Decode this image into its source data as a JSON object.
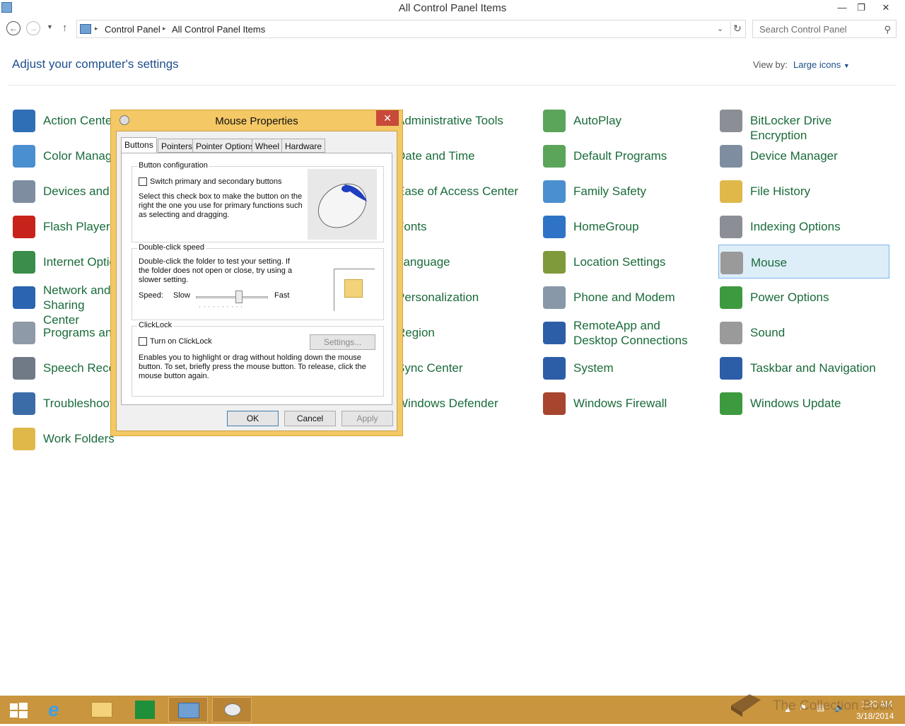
{
  "window": {
    "title": "All Control Panel Items"
  },
  "address": {
    "crumbs": [
      "Control Panel",
      "All Control Panel Items"
    ],
    "search_placeholder": "Search Control Panel"
  },
  "main": {
    "heading": "Adjust your computer's settings",
    "view_by_label": "View by:",
    "view_by_value": "Large icons"
  },
  "items": [
    {
      "label": "Action Center",
      "icon": "flag-icon",
      "color": "#2f6fb5"
    },
    {
      "label": "Color Management",
      "icon": "color-management-icon",
      "color": "#4a8fcf"
    },
    {
      "label": "Devices and Printers",
      "icon": "devices-printers-icon",
      "color": "#7e8ea0"
    },
    {
      "label": "Flash Player (32-bit)",
      "icon": "flash-icon",
      "color": "#c8231b"
    },
    {
      "label": "Internet Options",
      "icon": "internet-options-icon",
      "color": "#3a8d4a"
    },
    {
      "label": "Network and Sharing Center",
      "icon": "network-icon",
      "color": "#2b64b0"
    },
    {
      "label": "Programs and Features",
      "icon": "programs-icon",
      "color": "#8e9aa8"
    },
    {
      "label": "Speech Recognition",
      "icon": "microphone-icon",
      "color": "#6f7a86"
    },
    {
      "label": "Troubleshooting",
      "icon": "troubleshooting-icon",
      "color": "#3b6ca8"
    },
    {
      "label": "Work Folders",
      "icon": "work-folders-icon",
      "color": "#e0b84a"
    },
    {
      "label": "Administrative Tools",
      "icon": "admin-tools-icon",
      "color": "#777777"
    },
    {
      "label": "Date and Time",
      "icon": "clock-icon",
      "color": "#4b7fc0"
    },
    {
      "label": "Ease of Access Center",
      "icon": "ease-access-icon",
      "color": "#2d7ac8"
    },
    {
      "label": "Fonts",
      "icon": "fonts-icon",
      "color": "#e0b84a"
    },
    {
      "label": "Language",
      "icon": "language-icon",
      "color": "#3d6db0"
    },
    {
      "label": "Personalization",
      "icon": "personalization-icon",
      "color": "#5b8fd0"
    },
    {
      "label": "Region",
      "icon": "region-icon",
      "color": "#3b7d4a"
    },
    {
      "label": "Sync Center",
      "icon": "sync-icon",
      "color": "#3e9a3e"
    },
    {
      "label": "Windows Defender",
      "icon": "defender-icon",
      "color": "#4a6d8c"
    },
    {
      "label": "AutoPlay",
      "icon": "autoplay-icon",
      "color": "#5aa55a"
    },
    {
      "label": "Default Programs",
      "icon": "default-programs-icon",
      "color": "#5aa55a"
    },
    {
      "label": "Family Safety",
      "icon": "family-safety-icon",
      "color": "#4a8fd0"
    },
    {
      "label": "HomeGroup",
      "icon": "homegroup-icon",
      "color": "#2f73c6"
    },
    {
      "label": "Location Settings",
      "icon": "location-icon",
      "color": "#7f9a3a"
    },
    {
      "label": "Phone and Modem",
      "icon": "phone-icon",
      "color": "#8898a8"
    },
    {
      "label": "RemoteApp and Desktop Connections",
      "icon": "remoteapp-icon",
      "color": "#2c5ea8"
    },
    {
      "label": "System",
      "icon": "system-icon",
      "color": "#2c5ea8"
    },
    {
      "label": "Windows Firewall",
      "icon": "firewall-icon",
      "color": "#a8452e"
    },
    {
      "label": "BitLocker Drive Encryption",
      "icon": "bitlocker-icon",
      "color": "#8b8f95"
    },
    {
      "label": "Device Manager",
      "icon": "device-manager-icon",
      "color": "#7e8ea0"
    },
    {
      "label": "File History",
      "icon": "file-history-icon",
      "color": "#e0b84a"
    },
    {
      "label": "Indexing Options",
      "icon": "indexing-icon",
      "color": "#8b8f95"
    },
    {
      "label": "Mouse",
      "icon": "mouse-icon",
      "color": "#9a9a9a"
    },
    {
      "label": "Power Options",
      "icon": "power-icon",
      "color": "#3e9a3e"
    },
    {
      "label": "Sound",
      "icon": "sound-icon",
      "color": "#9a9a9a"
    },
    {
      "label": "Taskbar and Navigation",
      "icon": "taskbar-icon",
      "color": "#2c5ea8"
    },
    {
      "label": "Windows Update",
      "icon": "windows-update-icon",
      "color": "#3e9a3e"
    }
  ],
  "dialog": {
    "title": "Mouse Properties",
    "tabs": [
      "Buttons",
      "Pointers",
      "Pointer Options",
      "Wheel",
      "Hardware"
    ],
    "button_config": {
      "title": "Button configuration",
      "checkbox_label": "Switch primary and secondary buttons",
      "description": "Select this check box to make the button on the right the one you use for primary functions such as selecting and dragging."
    },
    "double_click": {
      "title": "Double-click speed",
      "description": "Double-click the folder to test your setting. If the folder does not open or close, try using a slower setting.",
      "speed_label": "Speed:",
      "slow": "Slow",
      "fast": "Fast"
    },
    "clicklock": {
      "title": "ClickLock",
      "checkbox_label": "Turn on ClickLock",
      "settings_button": "Settings...",
      "description": "Enables you to highlight or drag without holding down the mouse button. To set, briefly press the mouse button. To release, click the mouse button again."
    },
    "buttons": {
      "ok": "OK",
      "cancel": "Cancel",
      "apply": "Apply"
    }
  },
  "taskbar": {
    "time": "1:20 AM",
    "date": "3/18/2014",
    "watermark": "The Collection Book"
  }
}
